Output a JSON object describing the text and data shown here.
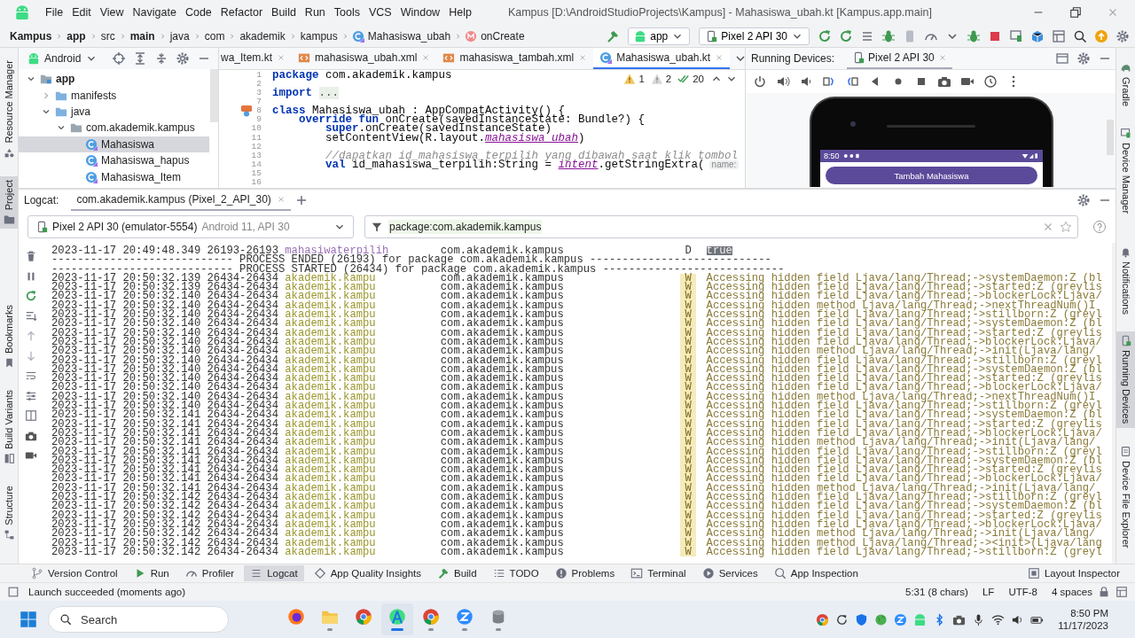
{
  "window": {
    "title": "Kampus [D:\\AndroidStudioProjects\\Kampus] - Mahasiswa_ubah.kt [Kampus.app.main]"
  },
  "menu": [
    "File",
    "Edit",
    "View",
    "Navigate",
    "Code",
    "Refactor",
    "Build",
    "Run",
    "Tools",
    "VCS",
    "Window",
    "Help"
  ],
  "breadcrumbs": [
    {
      "label": "Kampus",
      "kind": "module"
    },
    {
      "label": "app",
      "kind": "module"
    },
    {
      "label": "src",
      "kind": "folder"
    },
    {
      "label": "main",
      "kind": "module"
    },
    {
      "label": "java",
      "kind": "folder"
    },
    {
      "label": "com",
      "kind": "folder"
    },
    {
      "label": "akademik",
      "kind": "folder"
    },
    {
      "label": "kampus",
      "kind": "folder"
    },
    {
      "label": "Mahasiswa_ubah",
      "kind": "class"
    },
    {
      "label": "onCreate",
      "kind": "method"
    }
  ],
  "run_config": "app",
  "device_selector": "Pixel 2 API 30",
  "left_stripe": [
    {
      "label": "Resource Manager",
      "selected": false
    },
    {
      "label": "Project",
      "selected": true
    },
    {
      "label": "Bookmarks",
      "selected": false
    },
    {
      "label": "Build Variants",
      "selected": false
    },
    {
      "label": "Structure",
      "selected": false
    }
  ],
  "right_stripe": [
    {
      "label": "Gradle",
      "selected": false
    },
    {
      "label": "Device Manager",
      "selected": false
    },
    {
      "label": "Notifications",
      "selected": false
    },
    {
      "label": "Running Devices",
      "selected": true
    },
    {
      "label": "Device File Explorer",
      "selected": false
    }
  ],
  "project": {
    "view": "Android",
    "tree": [
      {
        "label": "app",
        "kind": "module",
        "expanded": true,
        "selected": false,
        "children": [
          {
            "label": "manifests",
            "kind": "folder",
            "expanded": false,
            "selected": false
          },
          {
            "label": "java",
            "kind": "folder",
            "expanded": true,
            "selected": false,
            "children": [
              {
                "label": "com.akademik.kampus",
                "kind": "package",
                "expanded": true,
                "selected": false,
                "children": [
                  {
                    "label": "Mahasiswa",
                    "kind": "class",
                    "selected": true
                  },
                  {
                    "label": "Mahasiswa_hapus",
                    "kind": "class",
                    "selected": false
                  },
                  {
                    "label": "Mahasiswa_Item",
                    "kind": "class",
                    "selected": false
                  }
                ]
              }
            ]
          }
        ]
      }
    ]
  },
  "editor_tabs": [
    {
      "label": "wa_Item.kt",
      "kind": "cut",
      "selected": false
    },
    {
      "label": "mahasiswa_ubah.xml",
      "kind": "xml",
      "selected": false
    },
    {
      "label": "mahasiswa_tambah.xml",
      "kind": "xml",
      "selected": false
    },
    {
      "label": "Mahasiswa_ubah.kt",
      "kind": "kotlin",
      "selected": true
    }
  ],
  "editor": {
    "inspections": {
      "warnings": "1",
      "weak_warnings": "2",
      "typos": "20"
    },
    "lines": [
      {
        "number": "1",
        "code": [
          {
            "kind": "keyword",
            "text": "package"
          },
          {
            "kind": "plain",
            "text": " com.akademik.kampus"
          }
        ]
      },
      {
        "number": "2"
      },
      {
        "number": "3",
        "code": [
          {
            "kind": "keyword",
            "text": "import"
          },
          {
            "kind": "fold",
            "text": "..."
          }
        ]
      },
      {
        "number": "7"
      },
      {
        "number": "8",
        "gutter": true,
        "code": [
          {
            "kind": "keyword",
            "text": "class"
          },
          {
            "kind": "plain",
            "text": " Mahasiswa_ubah : AppCompatActivity() {"
          }
        ],
        "children": [
          {
            "number": "9",
            "code": [
              {
                "kind": "keyword",
                "text": "override fun"
              },
              {
                "kind": "plain",
                "text": " onCreate(savedInstanceState: Bundle?) {"
              }
            ],
            "children": [
              {
                "number": "10",
                "code": [
                  {
                    "kind": "keyword",
                    "text": "super"
                  },
                  {
                    "kind": "plain",
                    "text": ".onCreate(savedInstanceState)"
                  }
                ]
              },
              {
                "number": "11",
                "code": [
                  {
                    "kind": "plain",
                    "text": "setContentView(R.layout."
                  },
                  {
                    "kind": "ref",
                    "text": "mahasiswa_ubah"
                  },
                  {
                    "kind": "plain",
                    "text": ")"
                  }
                ]
              },
              {
                "number": "12"
              },
              {
                "number": "13",
                "code": [
                  {
                    "kind": "comment",
                    "text": "//dapatkan id_mahasiswa_terpilih yang dibawah saat klik tombol"
                  }
                ]
              },
              {
                "number": "14",
                "code": [
                  {
                    "kind": "keyword",
                    "text": "val"
                  },
                  {
                    "kind": "plain",
                    "text": " id_mahasiswa_terpilih:String = "
                  },
                  {
                    "kind": "ref",
                    "text": "intent"
                  },
                  {
                    "kind": "plain",
                    "text": ".getStringExtra("
                  }
                ],
                "hint": "name:"
              },
              {
                "number": "15"
              },
              {
                "number": "16"
              }
            ]
          }
        ]
      }
    ]
  },
  "running_devices": {
    "label": "Running Devices:",
    "tab": "Pixel 2 API 30",
    "phone": {
      "time": "8:50",
      "button": "Tambah Mahasiswa"
    }
  },
  "logcat": {
    "label": "Logcat:",
    "tab": "com.akademik.kampus (Pixel_2_API_30)",
    "device": "Pixel 2 API 30 (emulator-5554)",
    "device_api": "Android 11, API 30",
    "filter": "package:com.akademik.kampus",
    "rows": [
      {
        "kind": "entry",
        "date_time": "2023-11-17 20:49:48.349",
        "pid": "26193-26193",
        "tag": "mahasiwaterpilih",
        "color": "#9b6fb5",
        "package": "com.akademik.kampus",
        "priority": "D",
        "warning": false,
        "highlighted": true,
        "message": "true"
      },
      {
        "kind": "separator",
        "text": "---------------------------- PROCESS ENDED (26193) for package com.akademik.kampus ----------------------------"
      },
      {
        "kind": "separator",
        "text": "---------------------------- PROCESS STARTED (26434) for package com.akademik.kampus ----------------------------"
      },
      {
        "kind": "entry",
        "date_time": "2023-11-17 20:50:32.139",
        "pid": "26434-26434",
        "tag": "akademik.kampu",
        "color": "#9a962c",
        "package": "com.akademik.kampus",
        "priority": "W",
        "warning": true,
        "highlighted": false,
        "message": "Accessing hidden field Ljava/lang/Thread;->systemDaemon:Z (bl"
      },
      {
        "kind": "entry",
        "date_time": "2023-11-17 20:50:32.139",
        "pid": "26434-26434",
        "tag": "akademik.kampu",
        "color": "#9a962c",
        "package": "com.akademik.kampus",
        "priority": "W",
        "warning": true,
        "highlighted": false,
        "message": "Accessing hidden field Ljava/lang/Thread;->started:Z (greylis"
      },
      {
        "kind": "entry",
        "date_time": "2023-11-17 20:50:32.140",
        "pid": "26434-26434",
        "tag": "akademik.kampu",
        "color": "#9a962c",
        "package": "com.akademik.kampus",
        "priority": "W",
        "warning": true,
        "highlighted": false,
        "message": "Accessing hidden field Ljava/lang/Thread;->blockerLock:Ljava/"
      },
      {
        "kind": "entry",
        "date_time": "2023-11-17 20:50:32.140",
        "pid": "26434-26434",
        "tag": "akademik.kampu",
        "color": "#9a962c",
        "package": "com.akademik.kampus",
        "priority": "W",
        "warning": true,
        "highlighted": false,
        "message": "Accessing hidden method Ljava/lang/Thread;->nextThreadNum()I"
      },
      {
        "kind": "entry",
        "date_time": "2023-11-17 20:50:32.140",
        "pid": "26434-26434",
        "tag": "akademik.kampu",
        "color": "#9a962c",
        "package": "com.akademik.kampus",
        "priority": "W",
        "warning": true,
        "highlighted": false,
        "message": "Accessing hidden field Ljava/lang/Thread;->stillborn:Z (greyl"
      },
      {
        "kind": "entry",
        "date_time": "2023-11-17 20:50:32.140",
        "pid": "26434-26434",
        "tag": "akademik.kampu",
        "color": "#9a962c",
        "package": "com.akademik.kampus",
        "priority": "W",
        "warning": true,
        "highlighted": false,
        "message": "Accessing hidden field Ljava/lang/Thread;->systemDaemon:Z (bl"
      },
      {
        "kind": "entry",
        "date_time": "2023-11-17 20:50:32.140",
        "pid": "26434-26434",
        "tag": "akademik.kampu",
        "color": "#9a962c",
        "package": "com.akademik.kampus",
        "priority": "W",
        "warning": true,
        "highlighted": false,
        "message": "Accessing hidden field Ljava/lang/Thread;->started:Z (greylis"
      },
      {
        "kind": "entry",
        "date_time": "2023-11-17 20:50:32.140",
        "pid": "26434-26434",
        "tag": "akademik.kampu",
        "color": "#9a962c",
        "package": "com.akademik.kampus",
        "priority": "W",
        "warning": true,
        "highlighted": false,
        "message": "Accessing hidden field Ljava/lang/Thread;->blockerLock:Ljava/"
      },
      {
        "kind": "entry",
        "date_time": "2023-11-17 20:50:32.140",
        "pid": "26434-26434",
        "tag": "akademik.kampu",
        "color": "#9a962c",
        "package": "com.akademik.kampus",
        "priority": "W",
        "warning": true,
        "highlighted": false,
        "message": "Accessing hidden method Ljava/lang/Thread;->init(Ljava/lang/"
      },
      {
        "kind": "entry",
        "date_time": "2023-11-17 20:50:32.140",
        "pid": "26434-26434",
        "tag": "akademik.kampu",
        "color": "#9a962c",
        "package": "com.akademik.kampus",
        "priority": "W",
        "warning": true,
        "highlighted": false,
        "message": "Accessing hidden field Ljava/lang/Thread;->stillborn:Z (greyl"
      },
      {
        "kind": "entry",
        "date_time": "2023-11-17 20:50:32.140",
        "pid": "26434-26434",
        "tag": "akademik.kampu",
        "color": "#9a962c",
        "package": "com.akademik.kampus",
        "priority": "W",
        "warning": true,
        "highlighted": false,
        "message": "Accessing hidden field Ljava/lang/Thread;->systemDaemon:Z (bl"
      },
      {
        "kind": "entry",
        "date_time": "2023-11-17 20:50:32.140",
        "pid": "26434-26434",
        "tag": "akademik.kampu",
        "color": "#9a962c",
        "package": "com.akademik.kampus",
        "priority": "W",
        "warning": true,
        "highlighted": false,
        "message": "Accessing hidden field Ljava/lang/Thread;->started:Z (greylis"
      },
      {
        "kind": "entry",
        "date_time": "2023-11-17 20:50:32.140",
        "pid": "26434-26434",
        "tag": "akademik.kampu",
        "color": "#9a962c",
        "package": "com.akademik.kampus",
        "priority": "W",
        "warning": true,
        "highlighted": false,
        "message": "Accessing hidden field Ljava/lang/Thread;->blockerLock:Ljava/"
      },
      {
        "kind": "entry",
        "date_time": "2023-11-17 20:50:32.140",
        "pid": "26434-26434",
        "tag": "akademik.kampu",
        "color": "#9a962c",
        "package": "com.akademik.kampus",
        "priority": "W",
        "warning": true,
        "highlighted": false,
        "message": "Accessing hidden method Ljava/lang/Thread;->nextThreadNum()I"
      },
      {
        "kind": "entry",
        "date_time": "2023-11-17 20:50:32.140",
        "pid": "26434-26434",
        "tag": "akademik.kampu",
        "color": "#9a962c",
        "package": "com.akademik.kampus",
        "priority": "W",
        "warning": true,
        "highlighted": false,
        "message": "Accessing hidden field Ljava/lang/Thread;->stillborn:Z (greyl"
      },
      {
        "kind": "entry",
        "date_time": "2023-11-17 20:50:32.141",
        "pid": "26434-26434",
        "tag": "akademik.kampu",
        "color": "#9a962c",
        "package": "com.akademik.kampus",
        "priority": "W",
        "warning": true,
        "highlighted": false,
        "message": "Accessing hidden field Ljava/lang/Thread;->systemDaemon:Z (bl"
      },
      {
        "kind": "entry",
        "date_time": "2023-11-17 20:50:32.141",
        "pid": "26434-26434",
        "tag": "akademik.kampu",
        "color": "#9a962c",
        "package": "com.akademik.kampus",
        "priority": "W",
        "warning": true,
        "highlighted": false,
        "message": "Accessing hidden field Ljava/lang/Thread;->started:Z (greylis"
      },
      {
        "kind": "entry",
        "date_time": "2023-11-17 20:50:32.141",
        "pid": "26434-26434",
        "tag": "akademik.kampu",
        "color": "#9a962c",
        "package": "com.akademik.kampus",
        "priority": "W",
        "warning": true,
        "highlighted": false,
        "message": "Accessing hidden field Ljava/lang/Thread;->blockerLock:Ljava/"
      },
      {
        "kind": "entry",
        "date_time": "2023-11-17 20:50:32.141",
        "pid": "26434-26434",
        "tag": "akademik.kampu",
        "color": "#9a962c",
        "package": "com.akademik.kampus",
        "priority": "W",
        "warning": true,
        "highlighted": false,
        "message": "Accessing hidden method Ljava/lang/Thread;->init(Ljava/lang/"
      },
      {
        "kind": "entry",
        "date_time": "2023-11-17 20:50:32.141",
        "pid": "26434-26434",
        "tag": "akademik.kampu",
        "color": "#9a962c",
        "package": "com.akademik.kampus",
        "priority": "W",
        "warning": true,
        "highlighted": false,
        "message": "Accessing hidden field Ljava/lang/Thread;->stillborn:Z (greyl"
      },
      {
        "kind": "entry",
        "date_time": "2023-11-17 20:50:32.141",
        "pid": "26434-26434",
        "tag": "akademik.kampu",
        "color": "#9a962c",
        "package": "com.akademik.kampus",
        "priority": "W",
        "warning": true,
        "highlighted": false,
        "message": "Accessing hidden field Ljava/lang/Thread;->systemDaemon:Z (bl"
      },
      {
        "kind": "entry",
        "date_time": "2023-11-17 20:50:32.141",
        "pid": "26434-26434",
        "tag": "akademik.kampu",
        "color": "#9a962c",
        "package": "com.akademik.kampus",
        "priority": "W",
        "warning": true,
        "highlighted": false,
        "message": "Accessing hidden field Ljava/lang/Thread;->started:Z (greylis"
      },
      {
        "kind": "entry",
        "date_time": "2023-11-17 20:50:32.141",
        "pid": "26434-26434",
        "tag": "akademik.kampu",
        "color": "#9a962c",
        "package": "com.akademik.kampus",
        "priority": "W",
        "warning": true,
        "highlighted": false,
        "message": "Accessing hidden field Ljava/lang/Thread;->blockerLock:Ljava/"
      },
      {
        "kind": "entry",
        "date_time": "2023-11-17 20:50:32.141",
        "pid": "26434-26434",
        "tag": "akademik.kampu",
        "color": "#9a962c",
        "package": "com.akademik.kampus",
        "priority": "W",
        "warning": true,
        "highlighted": false,
        "message": "Accessing hidden method Ljava/lang/Thread;->init(Ljava/lang/"
      },
      {
        "kind": "entry",
        "date_time": "2023-11-17 20:50:32.142",
        "pid": "26434-26434",
        "tag": "akademik.kampu",
        "color": "#9a962c",
        "package": "com.akademik.kampus",
        "priority": "W",
        "warning": true,
        "highlighted": false,
        "message": "Accessing hidden field Ljava/lang/Thread;->stillborn:Z (greyl"
      },
      {
        "kind": "entry",
        "date_time": "2023-11-17 20:50:32.142",
        "pid": "26434-26434",
        "tag": "akademik.kampu",
        "color": "#9a962c",
        "package": "com.akademik.kampus",
        "priority": "W",
        "warning": true,
        "highlighted": false,
        "message": "Accessing hidden field Ljava/lang/Thread;->systemDaemon:Z (bl"
      },
      {
        "kind": "entry",
        "date_time": "2023-11-17 20:50:32.142",
        "pid": "26434-26434",
        "tag": "akademik.kampu",
        "color": "#9a962c",
        "package": "com.akademik.kampus",
        "priority": "W",
        "warning": true,
        "highlighted": false,
        "message": "Accessing hidden field Ljava/lang/Thread;->started:Z (greylis"
      },
      {
        "kind": "entry",
        "date_time": "2023-11-17 20:50:32.142",
        "pid": "26434-26434",
        "tag": "akademik.kampu",
        "color": "#9a962c",
        "package": "com.akademik.kampus",
        "priority": "W",
        "warning": true,
        "highlighted": false,
        "message": "Accessing hidden field Ljava/lang/Thread;->blockerLock:Ljava/"
      },
      {
        "kind": "entry",
        "date_time": "2023-11-17 20:50:32.142",
        "pid": "26434-26434",
        "tag": "akademik.kampu",
        "color": "#9a962c",
        "package": "com.akademik.kampus",
        "priority": "W",
        "warning": true,
        "highlighted": false,
        "message": "Accessing hidden method Ljava/lang/Thread;->init(Ljava/lang/"
      },
      {
        "kind": "entry",
        "date_time": "2023-11-17 20:50:32.142",
        "pid": "26434-26434",
        "tag": "akademik.kampu",
        "color": "#9a962c",
        "package": "com.akademik.kampus",
        "priority": "W",
        "warning": true,
        "highlighted": false,
        "message": "Accessing hidden method Ljava/lang/Thread;-><init>(Ljava/lang"
      },
      {
        "kind": "entry",
        "date_time": "2023-11-17 20:50:32.142",
        "pid": "26434-26434",
        "tag": "akademik.kampu",
        "color": "#9a962c",
        "package": "com.akademik.kampus",
        "priority": "W",
        "warning": true,
        "highlighted": false,
        "message": "Accessing hidden field Ljava/lang/Thread;->stillborn:Z (greyl"
      }
    ]
  },
  "tool_windows": {
    "left": [
      {
        "label": "Version Control",
        "selected": false
      },
      {
        "label": "Run",
        "selected": false
      },
      {
        "label": "Profiler",
        "selected": false
      },
      {
        "label": "Logcat",
        "selected": true
      },
      {
        "label": "App Quality Insights",
        "selected": false
      },
      {
        "label": "Build",
        "selected": false
      },
      {
        "label": "TODO",
        "selected": false
      },
      {
        "label": "Problems",
        "selected": false
      },
      {
        "label": "Terminal",
        "selected": false
      },
      {
        "label": "Services",
        "selected": false
      },
      {
        "label": "App Inspection",
        "selected": false
      }
    ],
    "right": [
      {
        "label": "Layout Inspector",
        "selected": false
      }
    ]
  },
  "status_bar": {
    "message": "Launch succeeded (moments ago)",
    "items": [
      "5:31 (8 chars)",
      "LF",
      "UTF-8",
      "4 spaces"
    ]
  },
  "taskbar": {
    "search": {
      "placeholder": "Search"
    },
    "apps": [
      {
        "selected": false,
        "running": false
      },
      {
        "selected": false,
        "running": true
      },
      {
        "selected": false,
        "running": false
      },
      {
        "selected": true,
        "running": true
      },
      {
        "selected": false,
        "running": true
      },
      {
        "selected": false,
        "running": true
      },
      {
        "selected": false,
        "running": true
      }
    ],
    "time": "8:50 PM",
    "date": "11/17/2023"
  }
}
